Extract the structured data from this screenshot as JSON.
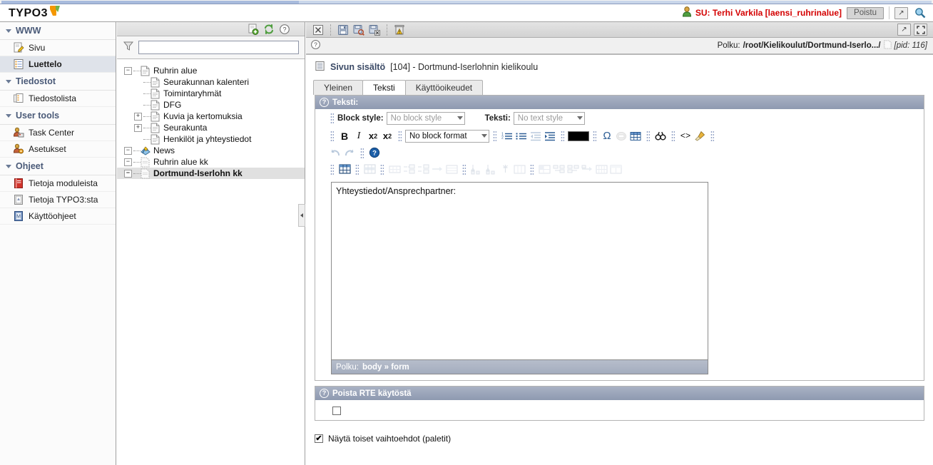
{
  "app": {
    "logo_text": "TYPO3"
  },
  "topbar": {
    "user_icon": "user-icon",
    "user_label": "SU:  Terhi Varkila [laensi_ruhrinalue]",
    "logout_label": "Poistu",
    "open_window_icon": "open-in-new-window-icon",
    "search_icon": "magnifier-icon"
  },
  "modmenu": {
    "groups": [
      {
        "label": "WWW",
        "items": [
          {
            "label": "Sivu",
            "icon": "page-edit-icon",
            "selected": false
          },
          {
            "label": "Luettelo",
            "icon": "list-icon",
            "selected": true
          }
        ]
      },
      {
        "label": "Tiedostot",
        "items": [
          {
            "label": "Tiedostolista",
            "icon": "folder-list-icon",
            "selected": false
          }
        ]
      },
      {
        "label": "User tools",
        "items": [
          {
            "label": "Task Center",
            "icon": "task-center-icon",
            "selected": false
          },
          {
            "label": "Asetukset",
            "icon": "user-settings-icon",
            "selected": false
          }
        ]
      },
      {
        "label": "Ohjeet",
        "items": [
          {
            "label": "Tietoja moduleista",
            "icon": "red-book-icon",
            "selected": false
          },
          {
            "label": "Tietoja TYPO3:sta",
            "icon": "info-icon",
            "selected": false
          },
          {
            "label": "Käyttöohjeet",
            "icon": "manual-icon",
            "selected": false
          }
        ]
      }
    ]
  },
  "tree": {
    "toolbar_icons": [
      "new-page-icon",
      "refresh-icon",
      "help-icon"
    ],
    "filter": {
      "icon": "filter-icon",
      "value": "",
      "placeholder": ""
    },
    "nodes": [
      {
        "label": "Ruhrin alue",
        "depth": 0,
        "toggle": "-",
        "icon": "page-icon",
        "selected": false
      },
      {
        "label": "Seurakunnan kalenteri",
        "depth": 1,
        "toggle": "",
        "icon": "page-icon",
        "selected": false
      },
      {
        "label": "Toimintaryhmät",
        "depth": 1,
        "toggle": "",
        "icon": "page-icon",
        "selected": false
      },
      {
        "label": "DFG",
        "depth": 1,
        "toggle": "",
        "icon": "page-icon",
        "selected": false
      },
      {
        "label": "Kuvia ja kertomuksia",
        "depth": 1,
        "toggle": "+",
        "icon": "page-icon",
        "selected": false
      },
      {
        "label": "Seurakunta",
        "depth": 1,
        "toggle": "+",
        "icon": "page-icon",
        "selected": false
      },
      {
        "label": "Henkilöt ja yhteystiedot",
        "depth": 1,
        "toggle": "",
        "icon": "page-icon",
        "selected": false
      },
      {
        "label": "News",
        "depth": 0,
        "toggle": "-",
        "icon": "news-icon",
        "selected": false
      },
      {
        "label": "Ruhrin alue kk",
        "depth": 0,
        "toggle": "-",
        "icon": "page-dim-icon",
        "selected": false
      },
      {
        "label": "Dortmund-Iserlohn kk",
        "depth": 0,
        "toggle": "-",
        "icon": "page-dim-icon",
        "selected": true
      }
    ],
    "collapse_handle_icon": "collapse-panel-icon"
  },
  "doc": {
    "toolbar": {
      "close_icon": "close-icon",
      "save_icon": "save-icon",
      "save_view_icon": "save-and-view-icon",
      "save_close_icon": "save-and-close-icon",
      "delete_icon": "delete-icon",
      "maximize_icon": "open-in-new-window-icon",
      "fullscreen_icon": "fullscreen-icon"
    },
    "help_icon": "help-icon",
    "path_label": "Polku:",
    "path_value": "/root/Kielikoulut/Dortmund-Iserlo.../",
    "path_page_icon": "page-icon",
    "pid_label": "[pid: 116]",
    "title_icon": "page-content-icon",
    "title_main": "Sivun sisältö",
    "title_rest": "[104] - Dortmund-Iserlohnin kielikoulu",
    "tabs": [
      {
        "label": "Yleinen",
        "active": false
      },
      {
        "label": "Teksti",
        "active": true
      },
      {
        "label": "Käyttöoikeudet",
        "active": false
      }
    ]
  },
  "rte": {
    "panel_title": "Teksti:",
    "block_style_label": "Block style:",
    "block_style_value": "No block style",
    "text_style_label": "Teksti:",
    "text_style_value": "No text style",
    "block_format_value": "No block format",
    "buttons_row2": [
      {
        "name": "bold-icon",
        "glyph": "B",
        "disabled": false
      },
      {
        "name": "italic-icon",
        "glyph": "I",
        "disabled": false
      },
      {
        "name": "subscript-icon",
        "glyph": "x₂",
        "disabled": false
      },
      {
        "name": "superscript-icon",
        "glyph": "x²",
        "disabled": false
      }
    ],
    "buttons_row2b": [
      {
        "name": "ordered-list-icon",
        "disabled": false
      },
      {
        "name": "unordered-list-icon",
        "disabled": false
      },
      {
        "name": "outdent-icon",
        "disabled": true
      },
      {
        "name": "indent-icon",
        "disabled": false
      }
    ],
    "color_swatch": "#000000",
    "buttons_row2c": [
      {
        "name": "special-character-icon",
        "glyph": "Ω",
        "disabled": false
      },
      {
        "name": "insert-image-icon",
        "glyph": "",
        "disabled": true
      },
      {
        "name": "insert-table-icon",
        "glyph": "",
        "disabled": false
      }
    ],
    "buttons_row2d": [
      {
        "name": "find-replace-icon",
        "glyph": "AA",
        "disabled": false
      },
      {
        "name": "source-code-icon",
        "glyph": "<>",
        "disabled": false
      },
      {
        "name": "clean-html-icon",
        "glyph": "",
        "disabled": false
      }
    ],
    "buttons_row3": [
      {
        "name": "undo-icon",
        "disabled": true
      },
      {
        "name": "redo-icon",
        "disabled": true
      },
      {
        "name": "rte-help-icon",
        "disabled": false
      }
    ],
    "buttons_row4": [
      {
        "name": "table-properties-icon",
        "disabled": false
      },
      {
        "name": "table-row-properties-icon",
        "disabled": true
      },
      {
        "name": "insert-row-above-icon",
        "disabled": true
      },
      {
        "name": "insert-row-under-icon",
        "disabled": true
      },
      {
        "name": "delete-row-icon",
        "disabled": true
      },
      {
        "name": "split-row-icon",
        "disabled": true
      },
      {
        "name": "merge-rows-icon",
        "disabled": true
      },
      {
        "name": "column-properties-icon",
        "disabled": true
      },
      {
        "name": "insert-column-left-icon",
        "disabled": true
      },
      {
        "name": "insert-column-right-icon",
        "disabled": true
      },
      {
        "name": "delete-column-icon",
        "disabled": true
      },
      {
        "name": "split-column-icon",
        "disabled": true
      },
      {
        "name": "merge-columns-icon",
        "disabled": true
      },
      {
        "name": "cell-properties-icon",
        "disabled": true
      },
      {
        "name": "insert-cell-before-icon",
        "disabled": true
      },
      {
        "name": "insert-cell-after-icon",
        "disabled": true
      },
      {
        "name": "delete-cell-icon",
        "disabled": true
      },
      {
        "name": "split-cell-icon",
        "disabled": true
      },
      {
        "name": "merge-cells-icon",
        "disabled": true
      }
    ],
    "content": "Yhteystiedot/Ansprechpartner:",
    "status_label": "Polku:",
    "status_path": "body » form",
    "drag_cursor_icon": "drag-content-cursor-icon"
  },
  "disable_rte": {
    "panel_title": "Poista RTE käytöstä",
    "checked": false
  },
  "bottom": {
    "palette_label": "Näytä toiset vaihtoehdot (paletit)",
    "palette_checked": true,
    "palette_tick": "✔"
  },
  "colors": {
    "brand_orange": "#f49700",
    "brand_green": "#73b348",
    "user_red": "#d40000",
    "panel_head": "#8e99b0",
    "selection": "#dfe3ea"
  }
}
